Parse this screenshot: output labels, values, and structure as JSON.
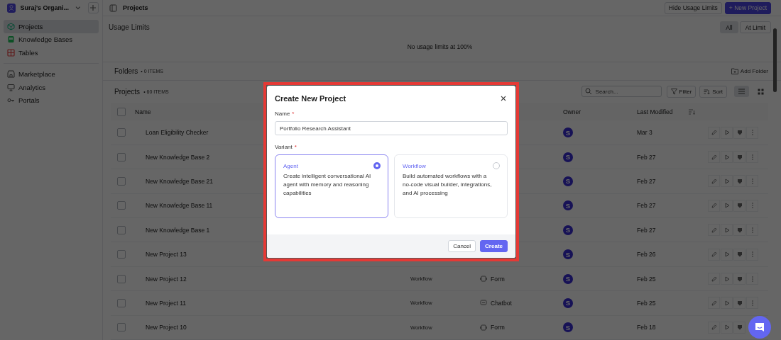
{
  "sidebar": {
    "org": {
      "name": "Suraj's Organi..."
    },
    "groups": [
      [
        {
          "label": "Projects",
          "selected": true
        },
        {
          "label": "Knowledge Bases",
          "selected": false
        },
        {
          "label": "Tables",
          "selected": false
        }
      ],
      [
        {
          "label": "Marketplace",
          "selected": false
        },
        {
          "label": "Analytics",
          "selected": false
        },
        {
          "label": "Portals",
          "selected": false
        }
      ]
    ]
  },
  "header": {
    "title": "Projects",
    "buttons": [
      {
        "label": "Hide Usage Limits",
        "kind": "plain"
      },
      {
        "label": "+ New Project",
        "kind": "primary"
      }
    ]
  },
  "usage_limits": {
    "title": "Usage Limits",
    "filters": [
      {
        "label": "All",
        "selected": true
      },
      {
        "label": "At Limit",
        "selected": false
      }
    ],
    "empty_text": "No usage limits at 100%"
  },
  "folders": {
    "title": "Folders",
    "count": "• 0 ITEMS",
    "add_button": "Add Folder"
  },
  "projects": {
    "title": "Projects",
    "count": "• 60 ITEMS",
    "search_placeholder": "Search...",
    "filter_button": "Filter",
    "sort_button": "Sort",
    "views": [
      {
        "selected": true
      },
      {
        "selected": false
      }
    ]
  },
  "table": {
    "select_all_checked": false,
    "columns": [
      "Name",
      "Owner",
      "Last Modified"
    ],
    "rows": [
      {
        "name": "Loan Eligibility Checker",
        "checked": false,
        "owner": "S",
        "modified": "Mar 3"
      },
      {
        "name": "New Knowledge Base 2",
        "checked": false,
        "owner": "S",
        "modified": "Feb 27"
      },
      {
        "name": "New Knowledge Base 21",
        "checked": false,
        "owner": "S",
        "modified": "Feb 27"
      },
      {
        "name": "New Knowledge Base 11",
        "checked": false,
        "owner": "S",
        "modified": "Feb 27"
      },
      {
        "name": "New Knowledge Base 1",
        "checked": false,
        "owner": "S",
        "modified": "Feb 27"
      },
      {
        "name": "New Project 13",
        "checked": false,
        "owner": "S",
        "modified": "Feb 26"
      },
      {
        "name": "New Project 12",
        "checked": false,
        "column_2": "Workflow",
        "column_3": {
          "kind": "form",
          "label": "Form"
        },
        "owner": "S",
        "modified": "Feb 25"
      },
      {
        "name": "New Project 11",
        "checked": false,
        "column_2": "Workflow",
        "column_3": {
          "kind": "chatbot",
          "label": "Chatbot"
        },
        "owner": "S",
        "modified": "Feb 25"
      },
      {
        "name": "New Project 10",
        "checked": false,
        "column_2": "Workflow",
        "column_3": {
          "kind": "form",
          "label": "Form"
        },
        "owner": "S",
        "modified": "Feb 18"
      }
    ]
  },
  "dialog": {
    "title": "Create New Project",
    "name_field": {
      "label": "Name",
      "required_mark": "*",
      "value": "Portfolio Research Assistant"
    },
    "variant_field": {
      "label": "Variant",
      "required_mark": "*",
      "options": [
        {
          "title": "Agent",
          "description": "Create intelligent conversational AI agent with memory and reasoning capabilities",
          "selected": true
        },
        {
          "title": "Workflow",
          "description": "Build automated workflows with a no-code visual builder, integrations, and AI processing",
          "selected": false
        }
      ]
    },
    "buttons": [
      {
        "label": "Cancel",
        "kind": "plain"
      },
      {
        "label": "Create",
        "kind": "primary"
      }
    ]
  }
}
